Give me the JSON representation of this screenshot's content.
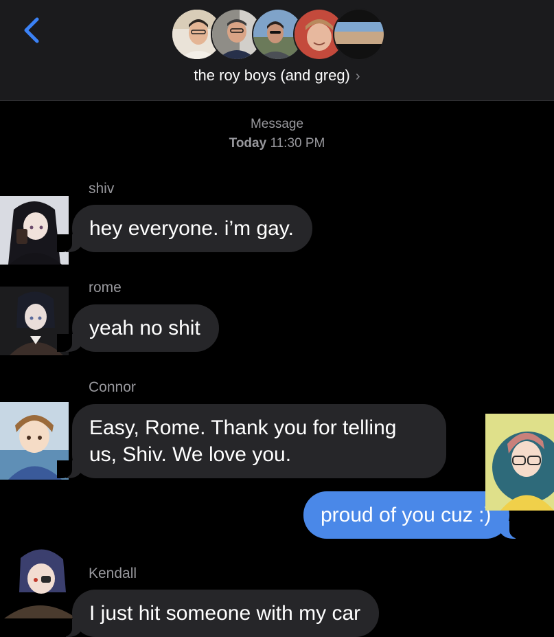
{
  "header": {
    "group_name": "the roy boys (and greg)",
    "chevron": "›",
    "back_icon": "chevron-left-icon",
    "accent": "#3b82f6",
    "member_avatars": [
      "member-avatar-1",
      "member-avatar-2",
      "member-avatar-3",
      "member-avatar-4",
      "member-avatar-5"
    ]
  },
  "thread": {
    "service_label": "Message",
    "date_bold": "Today",
    "time": "11:30 PM"
  },
  "messages": [
    {
      "sender": "shiv",
      "text": "hey everyone. i’m gay.",
      "direction": "incoming"
    },
    {
      "sender": "rome",
      "text": "yeah no shit",
      "direction": "incoming"
    },
    {
      "sender": "Connor",
      "text": "Easy, Rome. Thank you for telling us, Shiv. We love you.",
      "direction": "incoming"
    },
    {
      "sender": "",
      "text": "proud of you cuz :)",
      "direction": "outgoing"
    },
    {
      "sender": "Kendall",
      "text": "I just hit someone with my car",
      "direction": "incoming"
    }
  ],
  "colors": {
    "header_bg": "#1b1b1d",
    "incoming_bubble": "#262629",
    "outgoing_bubble": "#4a88e8",
    "secondary_text": "#98989d"
  }
}
